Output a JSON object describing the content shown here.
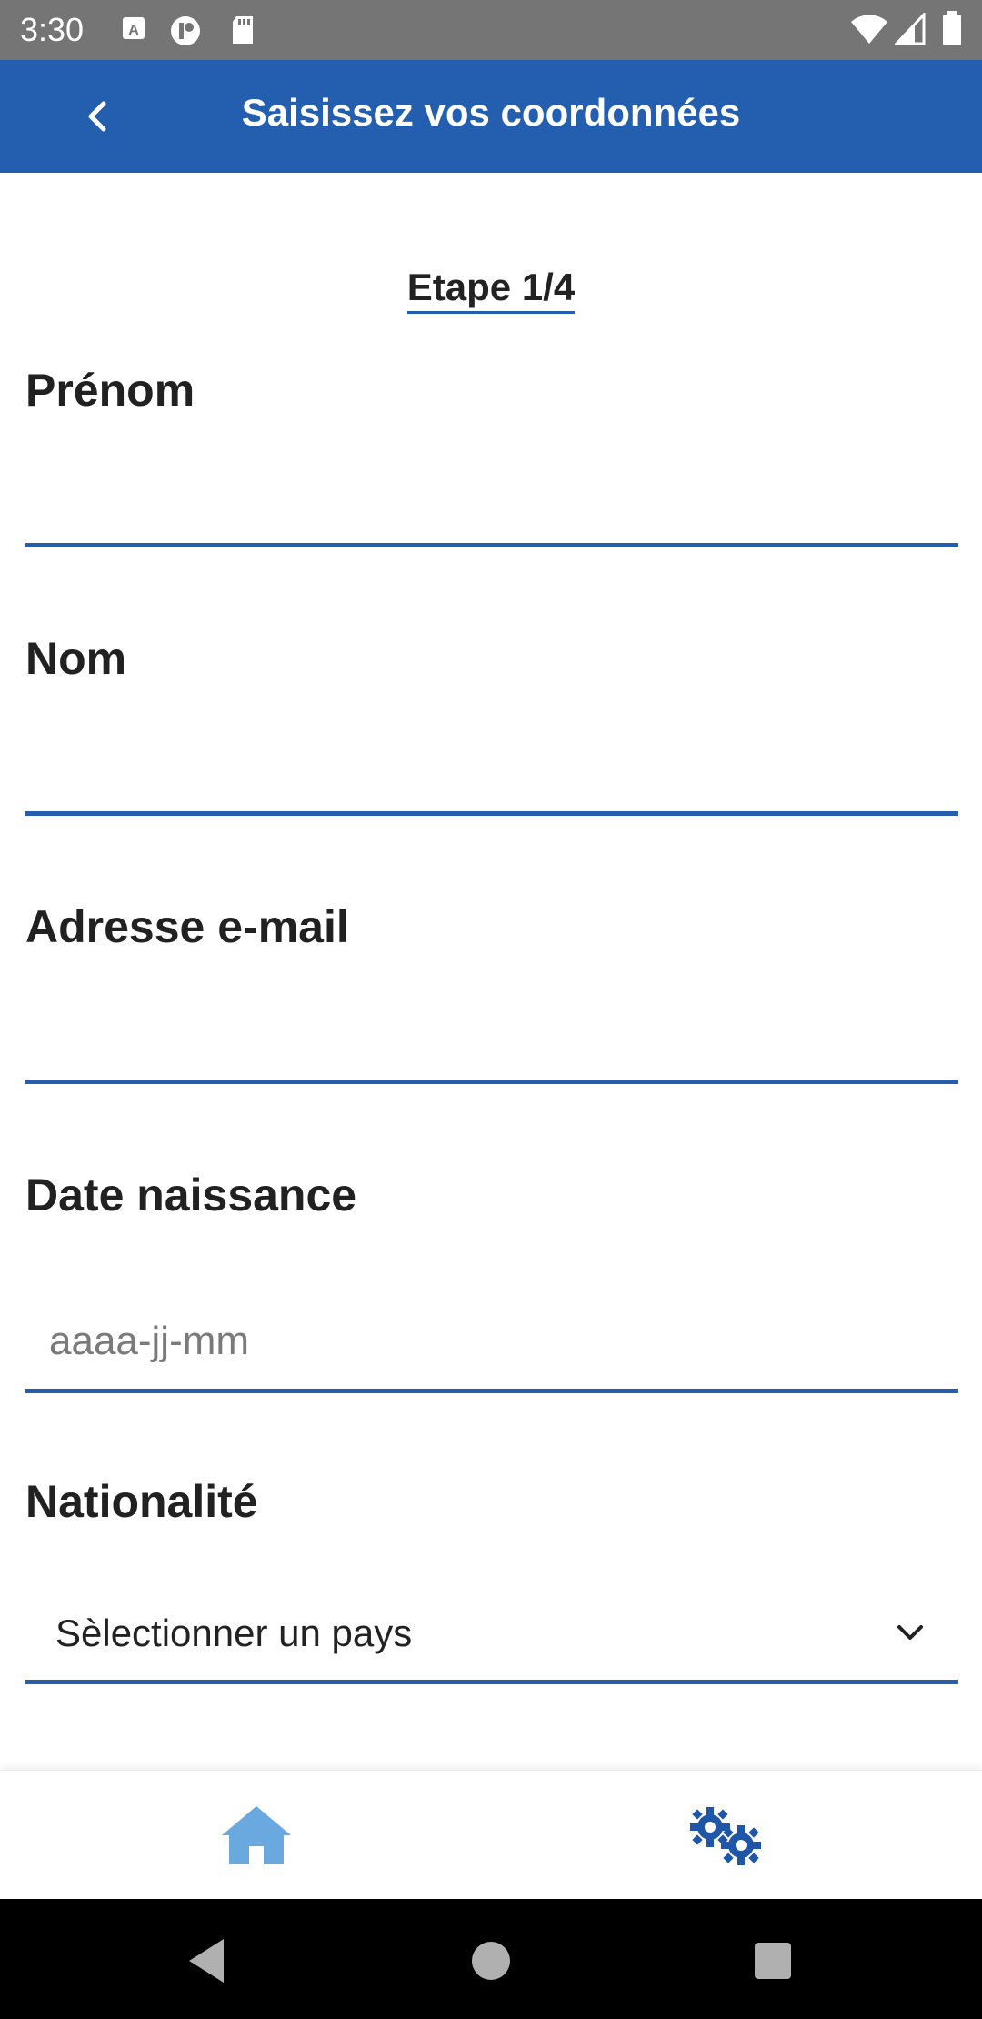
{
  "status_bar": {
    "time": "3:30"
  },
  "app_bar": {
    "title": "Saisissez vos coordonnées"
  },
  "step": {
    "label": "Etape 1/4"
  },
  "form": {
    "first_name": {
      "label": "Prénom",
      "value": "",
      "placeholder": ""
    },
    "last_name": {
      "label": "Nom",
      "value": "",
      "placeholder": ""
    },
    "email": {
      "label": "Adresse e-mail",
      "value": "",
      "placeholder": ""
    },
    "birth_date": {
      "label": "Date naissance",
      "value": "",
      "placeholder": "aaaa-jj-mm"
    },
    "nationality": {
      "label": "Nationalité",
      "selected": "Sèlectionner un pays"
    }
  },
  "bottom_nav": {
    "items": [
      {
        "icon": "home-icon",
        "active": true
      },
      {
        "icon": "settings-gears-icon",
        "active": false
      }
    ]
  },
  "colors": {
    "primary": "#235fae",
    "home_icon": "#6aa8e0",
    "settings_icon": "#1f56a8",
    "status_bar": "#757575"
  }
}
